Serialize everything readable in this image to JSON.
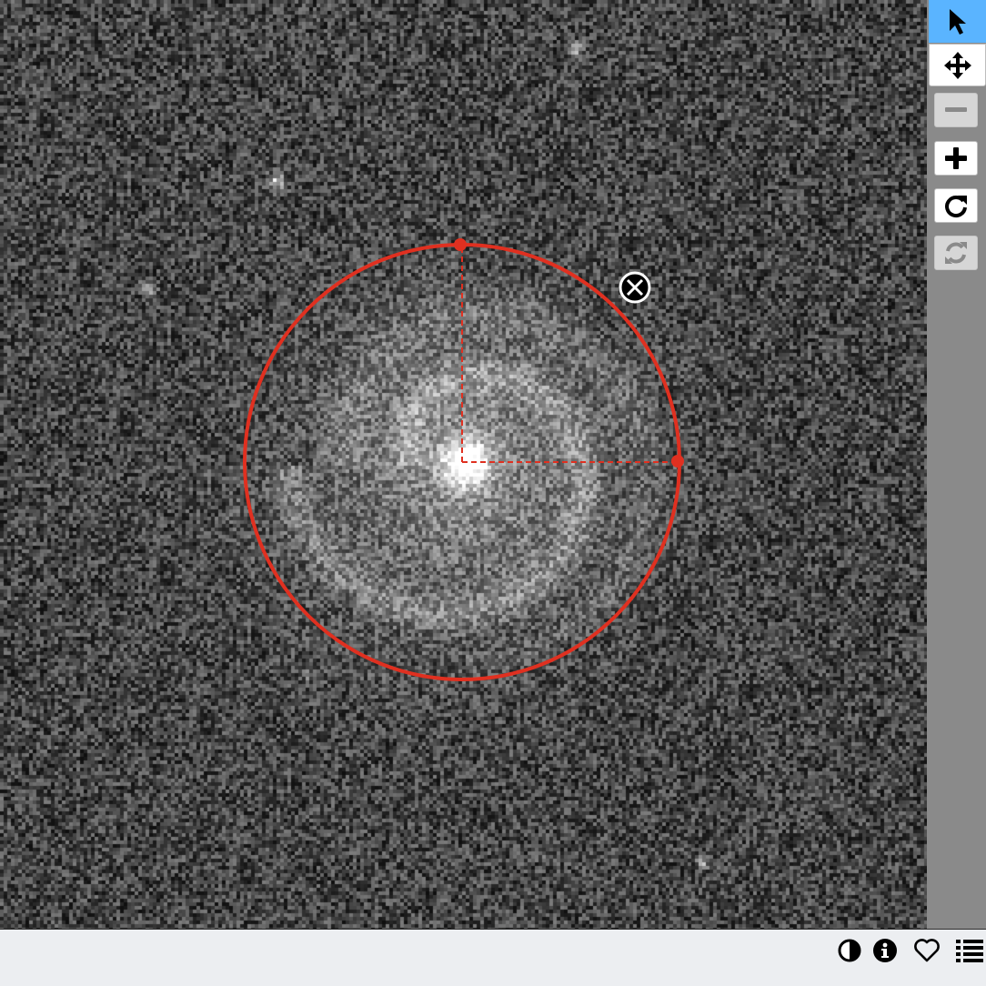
{
  "viewer": {
    "image_description": "",
    "region": {
      "shape": "circle",
      "color": "#e03020"
    }
  },
  "toolbar": {
    "tools": [
      {
        "name": "select-tool",
        "icon": "cursor-arrow-icon",
        "active": true,
        "enabled": true
      },
      {
        "name": "pan-tool",
        "icon": "move-arrows-icon",
        "active": false,
        "enabled": true
      },
      {
        "name": "zoom-out-button",
        "icon": "minus-icon",
        "active": false,
        "enabled": false
      },
      {
        "name": "zoom-in-button",
        "icon": "plus-icon",
        "active": false,
        "enabled": true
      },
      {
        "name": "rotate-button",
        "icon": "rotate-cw-icon",
        "active": false,
        "enabled": true
      },
      {
        "name": "reset-button",
        "icon": "refresh-icon",
        "active": false,
        "enabled": false
      }
    ]
  },
  "statusbar": {
    "icons": [
      "contrast-icon",
      "info-icon",
      "heart-icon",
      "list-icon"
    ]
  },
  "colors": {
    "accent": "#5ab4ff",
    "region": "#e03020",
    "toolbar_bg": "#8a8a8a",
    "statusbar_bg": "#eceef1"
  }
}
